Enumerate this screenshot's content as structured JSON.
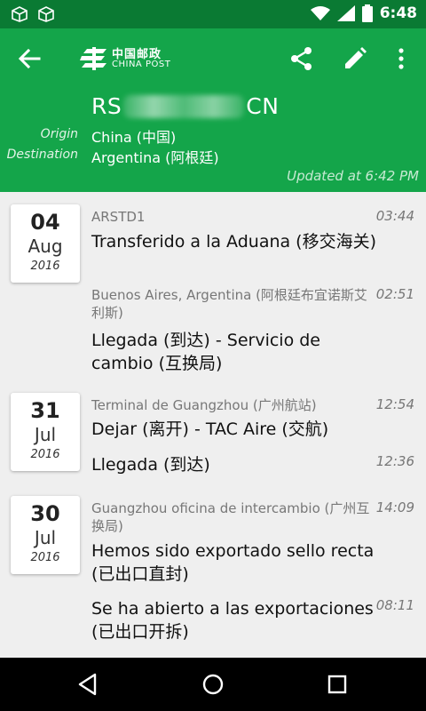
{
  "status_bar": {
    "time": "6:48",
    "icons": [
      "package-notification-icon",
      "package-notification-icon",
      "wifi-icon",
      "signal-icon",
      "battery-icon"
    ]
  },
  "toolbar": {
    "logo_cn": "中国邮政",
    "logo_en": "CHINA POST",
    "actions": [
      "back-icon",
      "share-icon",
      "edit-icon",
      "more-vert-icon"
    ]
  },
  "package": {
    "tracking_prefix": "RS",
    "tracking_suffix": "CN",
    "origin_label": "Origin",
    "origin_value": "China (中国)",
    "destination_label": "Destination",
    "destination_value": "Argentina (阿根廷)",
    "updated": "Updated at 6:42 PM"
  },
  "days": [
    {
      "day": "04",
      "month": "Aug",
      "year": "2016",
      "events": [
        {
          "location": "ARSTD1",
          "time": "03:44",
          "description": "Transferido a la Aduana (移交海关)"
        },
        {
          "location": "Buenos Aires, Argentina (阿根廷布宜诺斯艾利斯)",
          "time": "02:51",
          "description": "Llegada (到达) - Servicio de cambio (互换局)"
        }
      ]
    },
    {
      "day": "31",
      "month": "Jul",
      "year": "2016",
      "events": [
        {
          "location": "Terminal de Guangzhou (广州航站)",
          "time": "12:54",
          "description": "Dejar (离开) - TAC Aire (交航)"
        },
        {
          "location": "",
          "time": "12:36",
          "description": "Llegada (到达)"
        }
      ]
    },
    {
      "day": "30",
      "month": "Jul",
      "year": "2016",
      "events": [
        {
          "location": "Guangzhou oficina de intercambio (广州互换局)",
          "time": "14:09",
          "description": "Hemos sido exportado sello recta (已出口直封)"
        },
        {
          "location": "",
          "time": "08:11",
          "description": "Se ha abierto a las exportaciones (已出口开拆)"
        }
      ]
    }
  ],
  "nav_bar": [
    "back-triangle-icon",
    "home-circle-icon",
    "recents-square-icon"
  ],
  "colors": {
    "status_bar": "#0a7a33",
    "header": "#14a54a",
    "background": "#efefef"
  }
}
